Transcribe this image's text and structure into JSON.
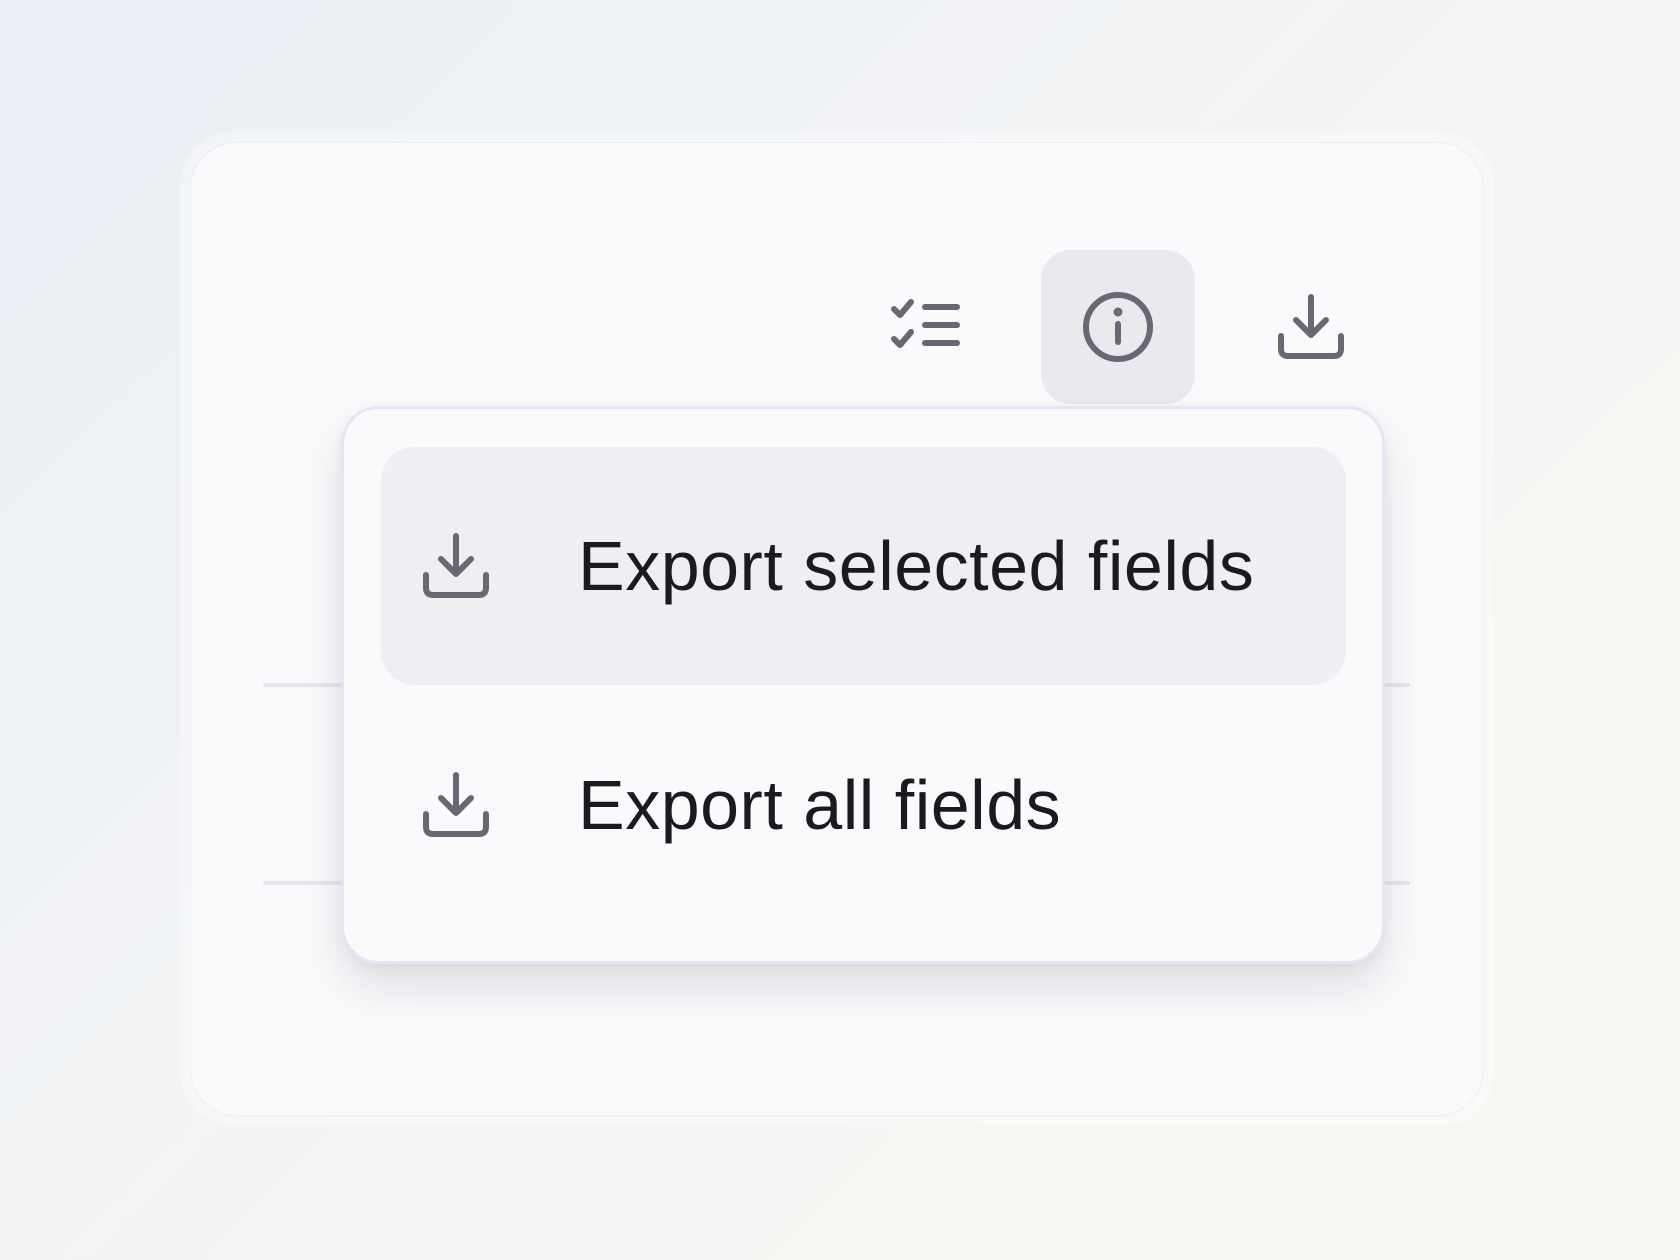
{
  "toolbar": {
    "buttons": [
      {
        "name": "checklist",
        "icon": "checklist-icon",
        "active": false
      },
      {
        "name": "info",
        "icon": "info-icon",
        "active": true
      },
      {
        "name": "download",
        "icon": "download-icon",
        "active": false
      }
    ]
  },
  "export_menu": {
    "items": [
      {
        "label": "Export selected fields",
        "icon": "download-icon",
        "highlighted": true
      },
      {
        "label": "Export all fields",
        "icon": "download-icon",
        "highlighted": false
      }
    ]
  },
  "colors": {
    "icon": "#676874",
    "active_button_bg": "#e9eaee",
    "highlight_bg": "#efeff3",
    "menu_border": "#e4e6f5",
    "text": "#1b1b1f"
  }
}
